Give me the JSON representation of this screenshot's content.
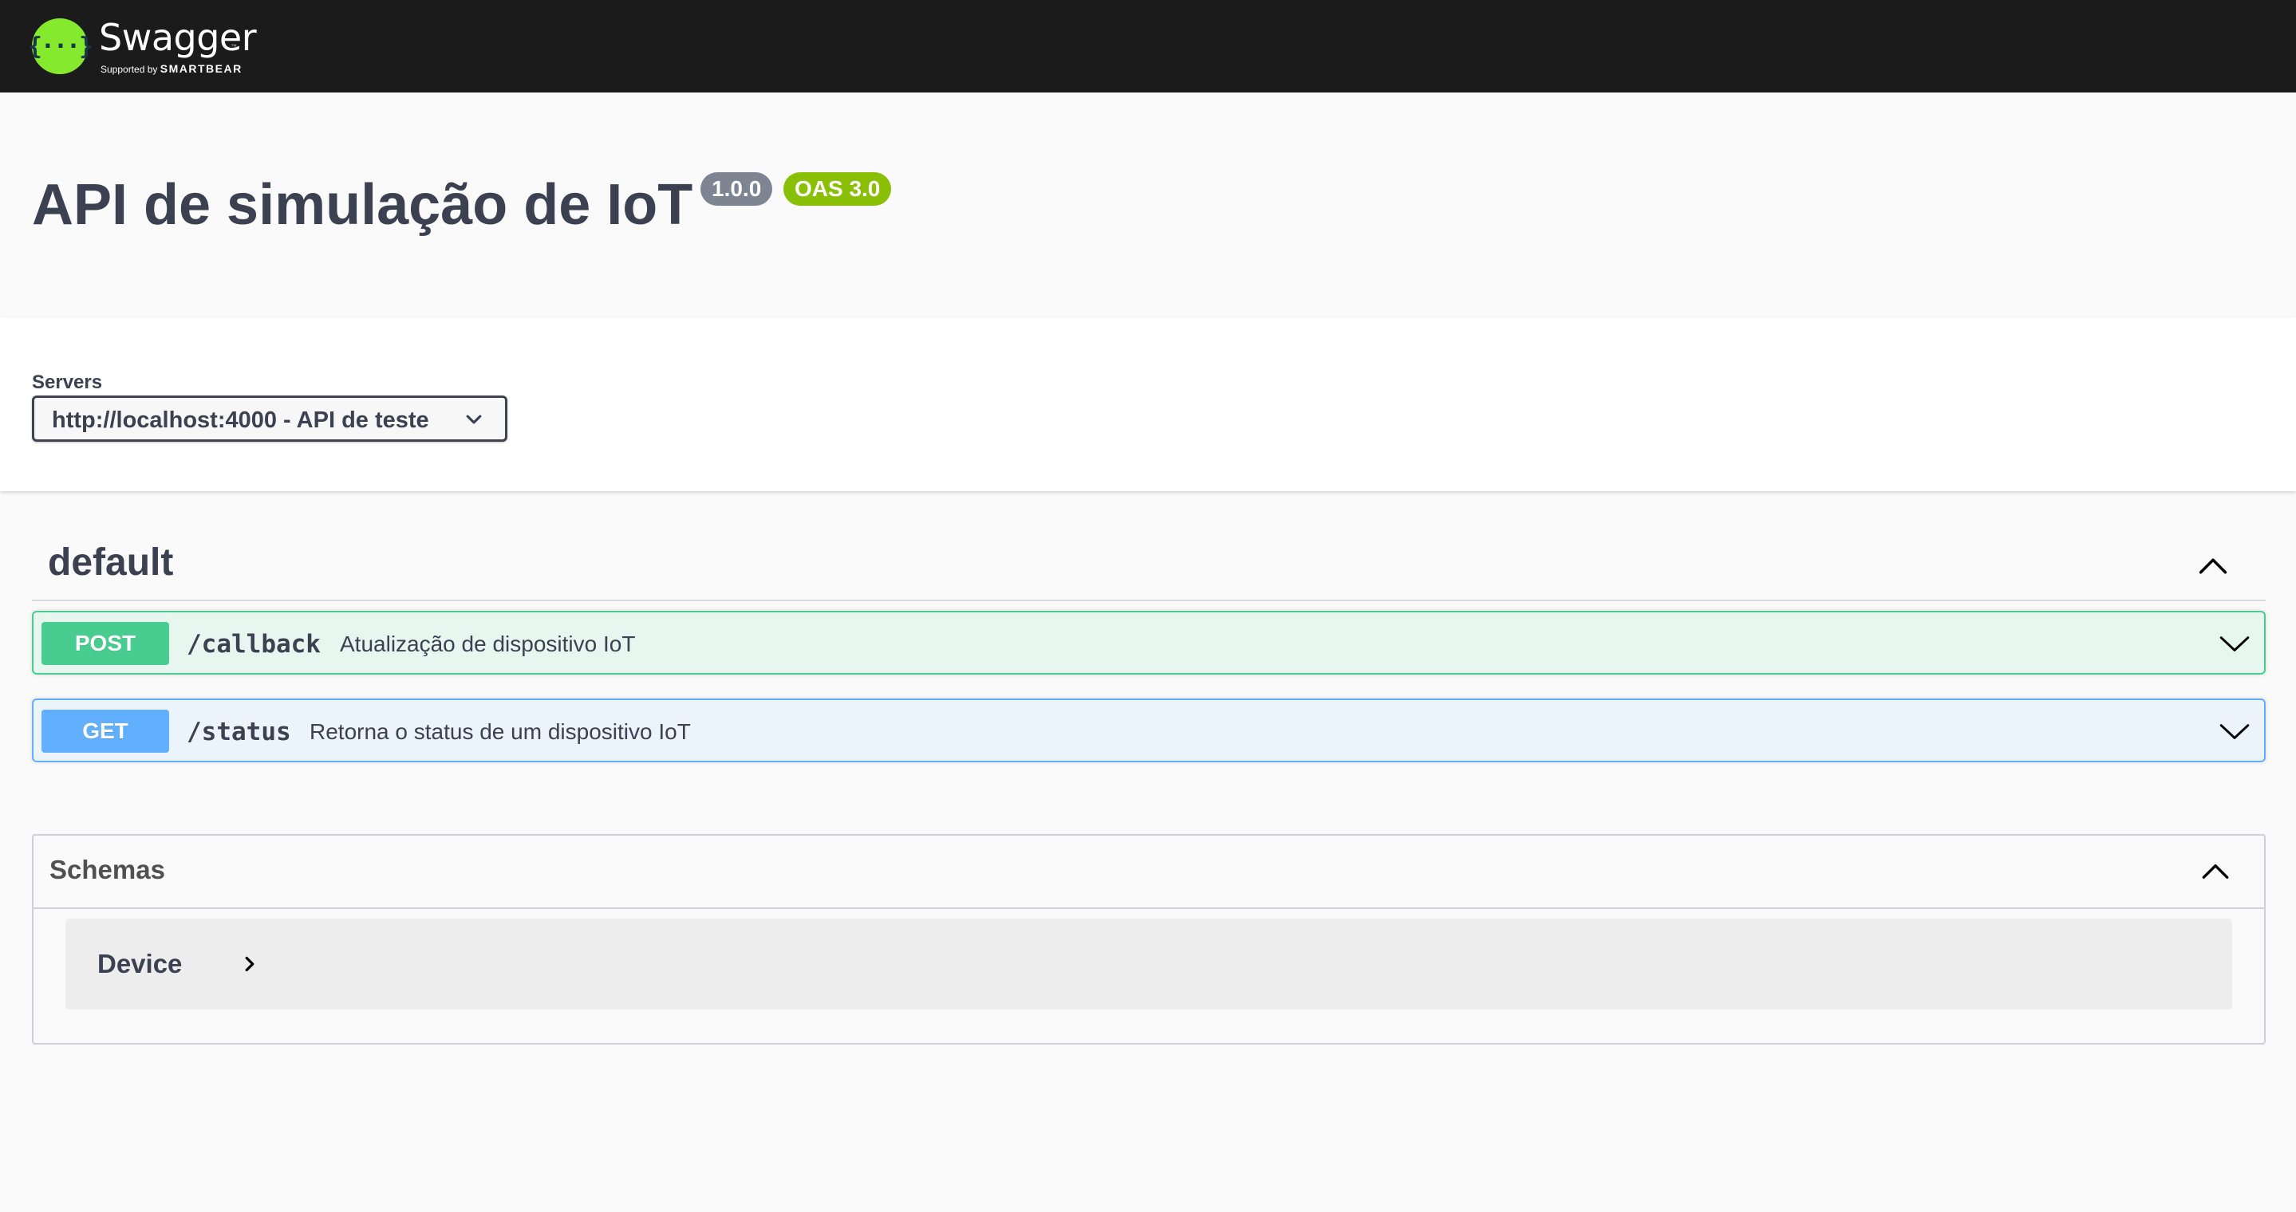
{
  "header": {
    "logo_glyph": "{···}",
    "brand": "Swagger",
    "tm": "™",
    "supported_by": "Supported by",
    "smartbear": "SMARTBEAR",
    "colors": {
      "bg": "#1b1b1b",
      "logo": "#85ea2d"
    }
  },
  "info": {
    "title": "API de simulação de IoT",
    "version": "1.0.0",
    "oas": "OAS 3.0"
  },
  "servers": {
    "label": "Servers",
    "selected": "http://localhost:4000 - API de teste"
  },
  "tag": {
    "name": "default",
    "operations": [
      {
        "method": "POST",
        "path": "/callback",
        "summary": "Atualização de dispositivo IoT",
        "color": "#49cc90"
      },
      {
        "method": "GET",
        "path": "/status",
        "summary": "Retorna o status de um dispositivo IoT",
        "color": "#61affe"
      }
    ]
  },
  "schemas": {
    "title": "Schemas",
    "models": [
      {
        "name": "Device"
      }
    ]
  }
}
